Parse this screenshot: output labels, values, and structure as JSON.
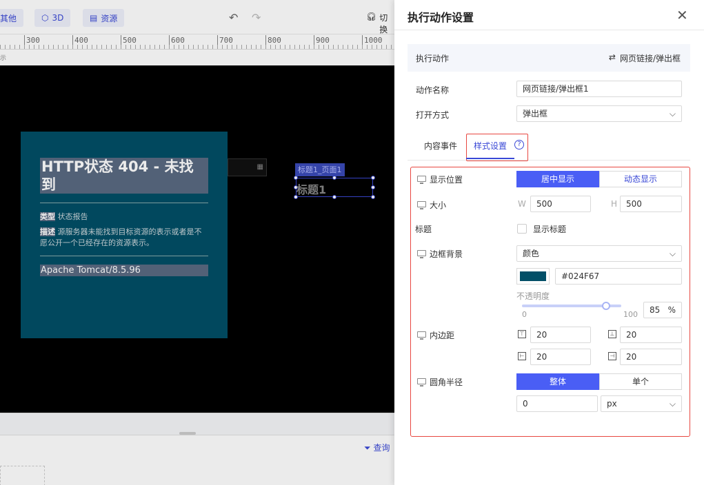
{
  "toolbar": {
    "other_label": "其他",
    "three_d_label": "3D",
    "resource_label": "资源",
    "switch_label": "切换"
  },
  "ruler": {
    "ticks": [
      "300",
      "400",
      "500",
      "600",
      "700",
      "800",
      "900",
      "1000"
    ],
    "hint": "示"
  },
  "canvas": {
    "widget_tag": "标题1_页面1",
    "widget_text": "标题1"
  },
  "preview": {
    "title": "HTTP状态 404 - 未找到",
    "type_label": "类型",
    "type_value": "状态报告",
    "desc_label": "描述",
    "desc_value": "源服务器未能找到目标资源的表示或者是不愿公开一个已经存在的资源表示。",
    "footer": "Apache Tomcat/8.5.96"
  },
  "bottom": {
    "query_label": "查询"
  },
  "drawer": {
    "title": "执行动作设置",
    "close_glyph": "✕",
    "action": {
      "label": "执行动作",
      "value": "网页链接/弹出框",
      "icon": "swap-icon"
    },
    "action_name": {
      "label": "动作名称",
      "value": "网页链接/弹出框1"
    },
    "open_mode": {
      "label": "打开方式",
      "value": "弹出框"
    },
    "tabs": {
      "content_events": "内容事件",
      "style_settings": "样式设置",
      "help_glyph": "?"
    },
    "style": {
      "position": {
        "label": "显示位置",
        "options": [
          "居中显示",
          "动态显示"
        ],
        "selected": "居中显示"
      },
      "size": {
        "label": "大小",
        "w_label": "W",
        "w_value": "500",
        "h_label": "H",
        "h_value": "500"
      },
      "title": {
        "label": "标题",
        "checkbox_label": "显示标题",
        "checked": false
      },
      "border_bg": {
        "label": "边框背景",
        "mode": "颜色",
        "color": "#024F67",
        "opacity_label": "不透明度",
        "opacity_min": "0",
        "opacity_max": "100",
        "opacity_value": "85",
        "opacity_unit": "%",
        "opacity_fraction": 0.85
      },
      "padding": {
        "label": "内边距",
        "top": "20",
        "bottom": "20",
        "left": "20",
        "right": "20"
      },
      "radius": {
        "label": "圆角半径",
        "options": [
          "整体",
          "单个"
        ],
        "selected": "整体",
        "value": "0",
        "unit": "px"
      }
    }
  },
  "colors": {
    "accent": "#4a5ef5",
    "link": "#3a48d6",
    "highlight_border": "#e8463f",
    "preview_bg": "#024F67"
  }
}
